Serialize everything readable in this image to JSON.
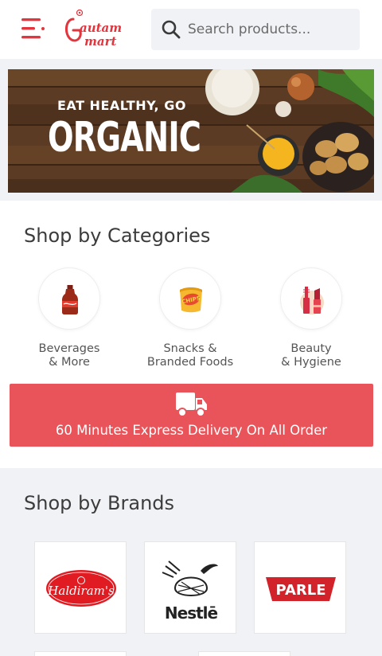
{
  "header": {
    "menu_icon": "hamburger-menu-icon",
    "logo": {
      "line1": "autam",
      "line2": "mart"
    },
    "search": {
      "placeholder": "Search products...",
      "icon": "search-icon"
    }
  },
  "banner": {
    "small_text": "EAT HEALTHY, GO",
    "big_text": "ORGANIC"
  },
  "categories": {
    "title": "Shop by Categories",
    "items": [
      {
        "label": "Beverages\n& More",
        "icon": "beverage-bottle-icon"
      },
      {
        "label": "Snacks &\nBranded Foods",
        "icon": "chips-packet-icon"
      },
      {
        "label": "Beauty\n& Hygiene",
        "icon": "lipstick-icon"
      }
    ]
  },
  "delivery": {
    "icon": "delivery-truck-icon",
    "text": "60 Minutes Express Delivery On All Order"
  },
  "brands": {
    "title": "Shop by Brands",
    "items": [
      {
        "name": "Haldiram's"
      },
      {
        "name": "Nestlē"
      },
      {
        "name": "PARLE"
      }
    ]
  },
  "colors": {
    "accent": "#e9545a",
    "background": "#f1f2f6",
    "logo_red": "#e2353d"
  }
}
